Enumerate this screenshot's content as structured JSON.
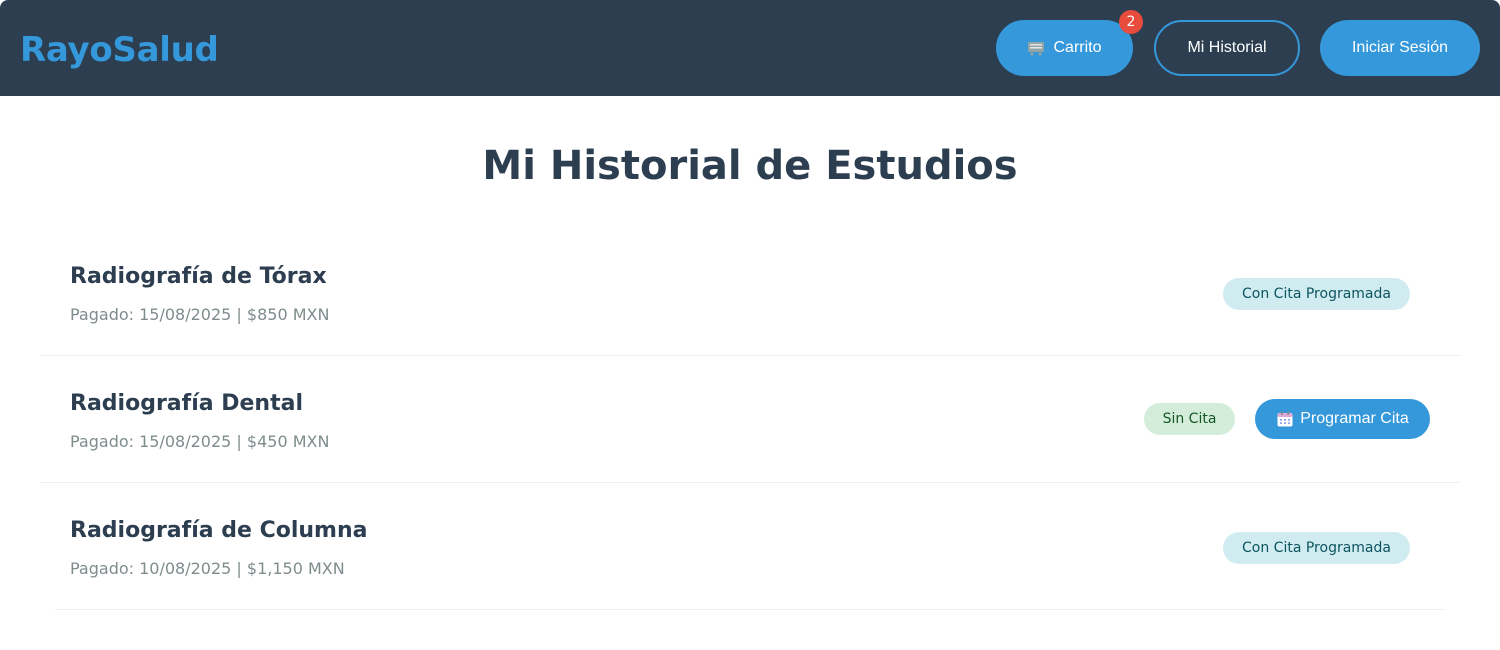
{
  "header": {
    "logo": "RayoSalud",
    "cart_label": "Carrito",
    "cart_icon": "cart-icon",
    "cart_count": "2",
    "history_label": "Mi Historial",
    "login_label": "Iniciar Sesión"
  },
  "main": {
    "title": "Mi Historial de Estudios",
    "studies": [
      {
        "name": "Radiografía de Tórax",
        "meta": "Pagado: 15/08/2025 | $850 MXN",
        "status": "Con Cita Programada"
      },
      {
        "name": "Radiografía Dental",
        "meta": "Pagado: 15/08/2025 | $450 MXN",
        "status": "Sin Cita",
        "action_label": "Programar Cita",
        "action_icon": "calendar-icon"
      },
      {
        "name": "Radiografía de Columna",
        "meta": "Pagado: 10/08/2025 | $1,150 MXN",
        "status": "Con Cita Programada"
      }
    ]
  },
  "colors": {
    "header_bg": "#2c3e50",
    "accent": "#3498db",
    "badge": "#e74c3c",
    "status_scheduled_bg": "#d1ecf1",
    "status_unscheduled_bg": "#d4edda"
  }
}
